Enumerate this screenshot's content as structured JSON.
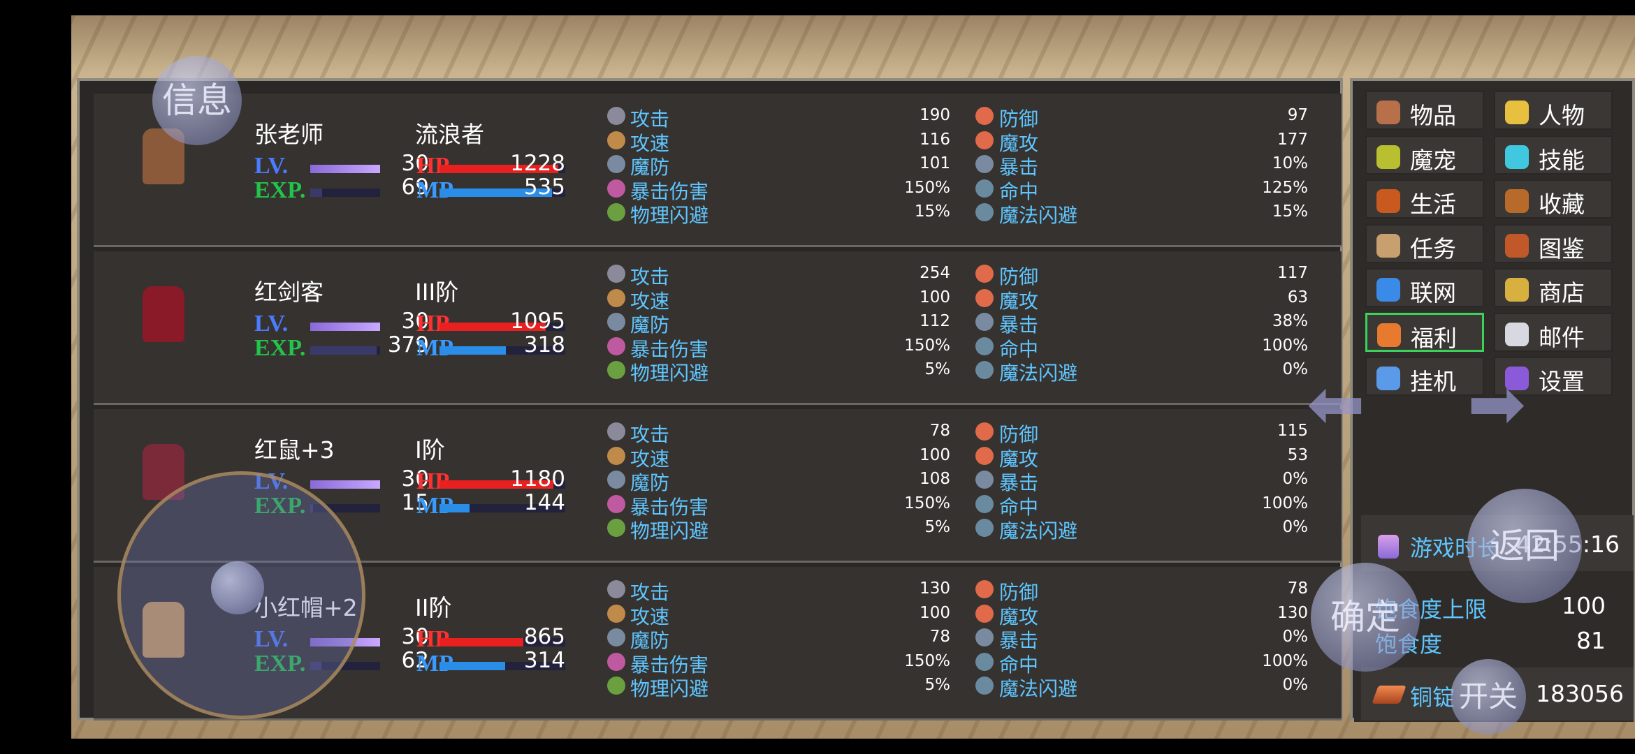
{
  "buttons": {
    "info": "信息",
    "back": "返回",
    "confirm": "确定",
    "toggle": "开关"
  },
  "characters": [
    {
      "name": "张老师",
      "class": "流浪者",
      "lv_label": "LV.",
      "lv": "30",
      "exp_label": "EXP.",
      "exp": "69",
      "hp_label": "HP",
      "hp": "1228",
      "mp_label": "MP",
      "mp": "535",
      "stats": {
        "atk": "190",
        "def": "97",
        "aspd": "116",
        "matk": "177",
        "mdef": "101",
        "crit": "10%",
        "critdmg": "150%",
        "hit": "125%",
        "pevade": "15%",
        "mevade": "15%"
      }
    },
    {
      "name": "红剑客",
      "class": "III阶",
      "lv_label": "LV.",
      "lv": "30",
      "exp_label": "EXP.",
      "exp": "379",
      "hp_label": "HP",
      "hp": "1095",
      "mp_label": "MP",
      "mp": "318",
      "stats": {
        "atk": "254",
        "def": "117",
        "aspd": "100",
        "matk": "63",
        "mdef": "112",
        "crit": "38%",
        "critdmg": "150%",
        "hit": "100%",
        "pevade": "5%",
        "mevade": "0%"
      }
    },
    {
      "name": "红鼠+3",
      "class": "I阶",
      "lv_label": "LV.",
      "lv": "30",
      "exp_label": "EXP.",
      "exp": "15",
      "hp_label": "HP",
      "hp": "1180",
      "mp_label": "MP",
      "mp": "144",
      "stats": {
        "atk": "78",
        "def": "115",
        "aspd": "100",
        "matk": "53",
        "mdef": "108",
        "crit": "0%",
        "critdmg": "150%",
        "hit": "100%",
        "pevade": "5%",
        "mevade": "0%"
      }
    },
    {
      "name": "小红帽+2",
      "class": "II阶",
      "lv_label": "LV.",
      "lv": "30",
      "exp_label": "EXP.",
      "exp": "62",
      "hp_label": "HP",
      "hp": "865",
      "mp_label": "MP",
      "mp": "314",
      "stats": {
        "atk": "130",
        "def": "78",
        "aspd": "100",
        "matk": "130",
        "mdef": "78",
        "crit": "0%",
        "critdmg": "150%",
        "hit": "100%",
        "pevade": "5%",
        "mevade": "0%"
      }
    }
  ],
  "stat_labels": {
    "atk": "攻击",
    "def": "防御",
    "aspd": "攻速",
    "matk": "魔攻",
    "mdef": "魔防",
    "crit": "暴击",
    "critdmg": "暴击伤害",
    "hit": "命中",
    "pevade": "物理闪避",
    "mevade": "魔法闪避"
  },
  "menu": [
    {
      "label": "物品",
      "icon": "bag-icon"
    },
    {
      "label": "人物",
      "icon": "helmet-icon"
    },
    {
      "label": "魔宠",
      "icon": "egg-icon"
    },
    {
      "label": "技能",
      "icon": "skill-icon"
    },
    {
      "label": "生活",
      "icon": "life-icon"
    },
    {
      "label": "收藏",
      "icon": "book-icon"
    },
    {
      "label": "任务",
      "icon": "scroll-icon"
    },
    {
      "label": "图鉴",
      "icon": "codex-icon"
    },
    {
      "label": "联网",
      "icon": "computer-icon"
    },
    {
      "label": "商店",
      "icon": "shop-icon"
    },
    {
      "label": "福利",
      "icon": "chest-icon"
    },
    {
      "label": "邮件",
      "icon": "mail-icon"
    },
    {
      "label": "挂机",
      "icon": "idle-icon"
    },
    {
      "label": "设置",
      "icon": "gear-icon"
    }
  ],
  "info": {
    "playtime_label": "游戏时长",
    "playtime": "42:55:16",
    "satiety_max_label": "饱食度上限",
    "satiety_max": "100",
    "satiety_label": "饱食度",
    "satiety": "81",
    "copper_label": "铜锭",
    "copper": "183056"
  },
  "colors": {
    "lv": "#4a7cff",
    "exp": "#22c44a",
    "hp": "#ff3030",
    "mp": "#3a9bff",
    "stat_label": "#5fc6ff"
  }
}
